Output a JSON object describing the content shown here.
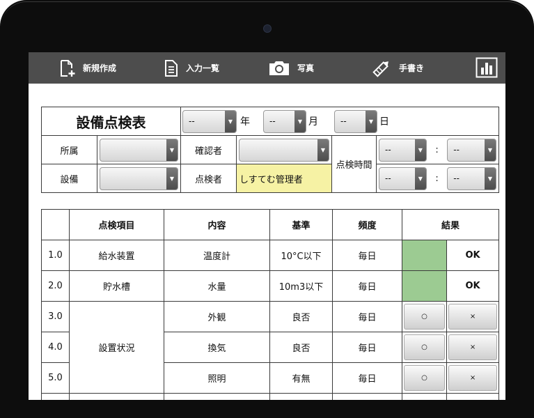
{
  "toolbar": {
    "new": "新規作成",
    "list": "入力一覧",
    "photo": "写真",
    "handwriting": "手書き"
  },
  "form": {
    "title": "設備点検表",
    "year_value": "--",
    "year_unit": "年",
    "month_value": "--",
    "month_unit": "月",
    "day_value": "--",
    "day_unit": "日",
    "affiliation_label": "所属",
    "affiliation_value": "",
    "confirmer_label": "確認者",
    "confirmer_value": "",
    "inspect_time_label": "点検時間",
    "time_start_h": "--",
    "time_start_m": "--",
    "time_end_h": "--",
    "time_end_m": "--",
    "colon": ":",
    "equipment_label": "設備",
    "equipment_value": "",
    "inspector_label": "点検者",
    "inspector_value": "しすてむ管理者"
  },
  "items_table": {
    "headers": [
      "",
      "点検項目",
      "内容",
      "基準",
      "頻度",
      "結果"
    ],
    "group_label": "設置状況",
    "good_symbol": "○",
    "bad_symbol": "×",
    "rows": [
      {
        "num": "1.0",
        "item": "給水装置",
        "content": "温度計",
        "standard": "10°C以下",
        "freq": "毎日",
        "result": "OK"
      },
      {
        "num": "2.0",
        "item": "貯水槽",
        "content": "水量",
        "standard": "10m3以下",
        "freq": "毎日",
        "result": "OK"
      },
      {
        "num": "3.0",
        "content": "外観",
        "standard": "良否",
        "freq": "毎日"
      },
      {
        "num": "4.0",
        "content": "換気",
        "standard": "良否",
        "freq": "毎日"
      },
      {
        "num": "5.0",
        "content": "照明",
        "standard": "有無",
        "freq": "毎日"
      }
    ]
  },
  "colors": {
    "toolbar": "#4d4d4d",
    "result_ok_fill": "#9ccb92",
    "ok_text": "#d0021b",
    "inspector_fill": "#f6f2a4"
  }
}
